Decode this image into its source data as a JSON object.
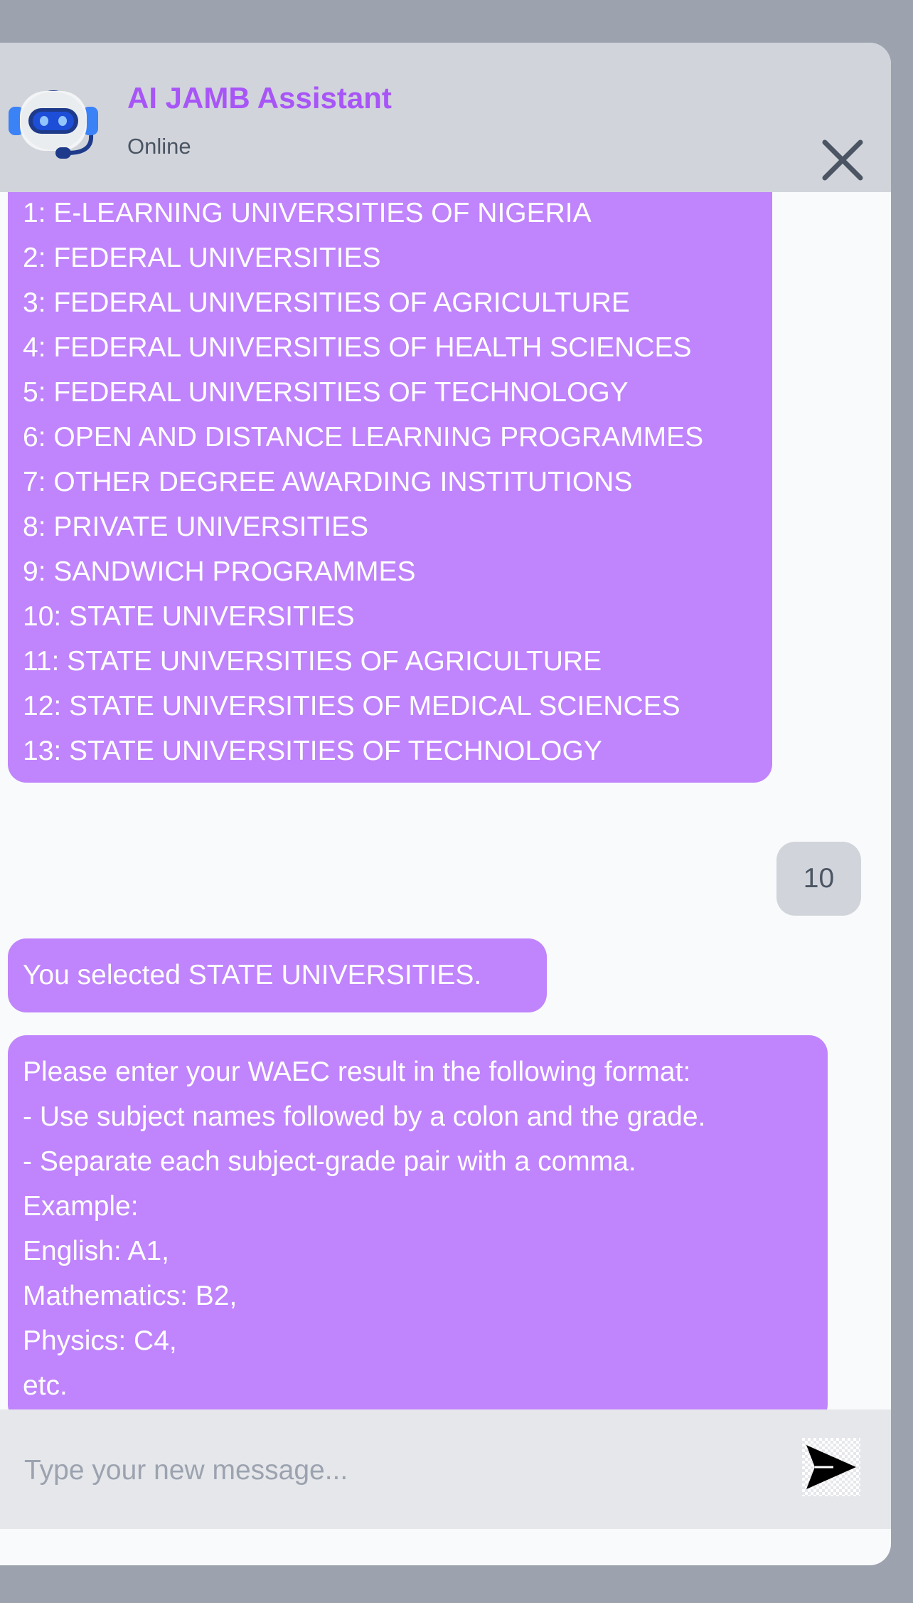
{
  "header": {
    "title": "AI JAMB Assistant",
    "status": "Online",
    "avatar_icon": "robot-headset-icon",
    "close_icon": "close-icon"
  },
  "messages": {
    "institution_list": [
      "1: E-LEARNING UNIVERSITIES OF NIGERIA",
      "2: FEDERAL UNIVERSITIES",
      "3: FEDERAL UNIVERSITIES OF AGRICULTURE",
      "4: FEDERAL UNIVERSITIES OF HEALTH SCIENCES",
      "5: FEDERAL UNIVERSITIES OF TECHNOLOGY",
      "6: OPEN AND DISTANCE LEARNING PROGRAMMES",
      "7: OTHER DEGREE AWARDING INSTITUTIONS",
      "8: PRIVATE UNIVERSITIES",
      "9: SANDWICH PROGRAMMES",
      "10: STATE UNIVERSITIES",
      "11: STATE UNIVERSITIES OF AGRICULTURE",
      "12: STATE UNIVERSITIES OF MEDICAL SCIENCES",
      "13: STATE UNIVERSITIES OF TECHNOLOGY"
    ],
    "user_reply": "10",
    "selection_confirmation": "You selected STATE UNIVERSITIES.",
    "instructions": [
      "Please enter your WAEC result in the following format:",
      "- Use subject names followed by a colon and the grade.",
      "- Separate each subject-grade pair with a comma.",
      "Example:",
      "English: A1,",
      "Mathematics: B2,",
      "Physics: C4,",
      "etc."
    ]
  },
  "composer": {
    "placeholder": "Type your new message...",
    "value": "",
    "send_icon": "send-icon"
  },
  "colors": {
    "accent": "#a855f7",
    "bot_bubble": "#c084fc",
    "user_bubble": "#d1d5db",
    "header_bg": "#d1d5db",
    "backdrop": "#9ca3af"
  }
}
